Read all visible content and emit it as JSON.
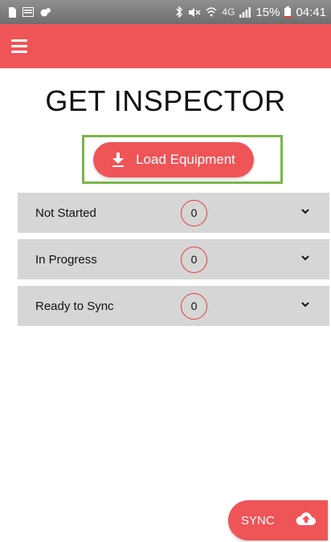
{
  "status_bar": {
    "left_icons": [
      "sim-card-icon",
      "message-icon",
      "notification-icon"
    ],
    "right_icons": [
      "bluetooth-icon",
      "mute-icon",
      "wifi-icon",
      "network-4g-icon",
      "signal-icon"
    ],
    "network": "4G",
    "battery": "15%",
    "time": "04:41"
  },
  "app_bar": {
    "menu_icon": "hamburger-menu-icon",
    "color": "#ef5457"
  },
  "main": {
    "title": "GET INSPECTOR",
    "load_button": {
      "label": "Load Equipment",
      "icon": "download-icon",
      "highlight_color": "#7ab648"
    },
    "status_rows": [
      {
        "label": "Not Started",
        "count": "0"
      },
      {
        "label": "In Progress",
        "count": "0"
      },
      {
        "label": "Ready to Sync",
        "count": "0"
      }
    ]
  },
  "sync_button": {
    "label": "SYNC",
    "icon": "cloud-upload-icon"
  },
  "colors": {
    "accent": "#ef5457",
    "row_background": "#d6d6d6",
    "badge_border": "#e53935"
  }
}
